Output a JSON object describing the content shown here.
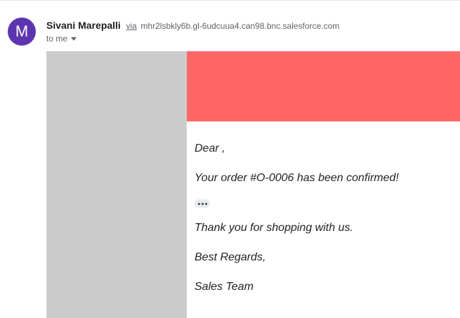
{
  "sender": {
    "avatar_letter": "M",
    "avatar_color": "#5e35b1",
    "name": "Sivani Marepalli",
    "via_label": "via",
    "via_domain": "mhr2lsbkly6b.gl-6udcuua4.can98.bnc.salesforce.com"
  },
  "recipient": {
    "label": "to me",
    "icon": "chevron-down-icon"
  },
  "email_body": {
    "banner_color": "#ff6666",
    "side_panel_color": "#cccccc",
    "greeting": "Dear ,",
    "order_message": "Your order #O-0006 has been confirmed!",
    "trimmed_content_icon": "dots-icon",
    "thanks_message": "Thank you for shopping with us.",
    "closing": "Best Regards,",
    "signature": "Sales Team"
  }
}
